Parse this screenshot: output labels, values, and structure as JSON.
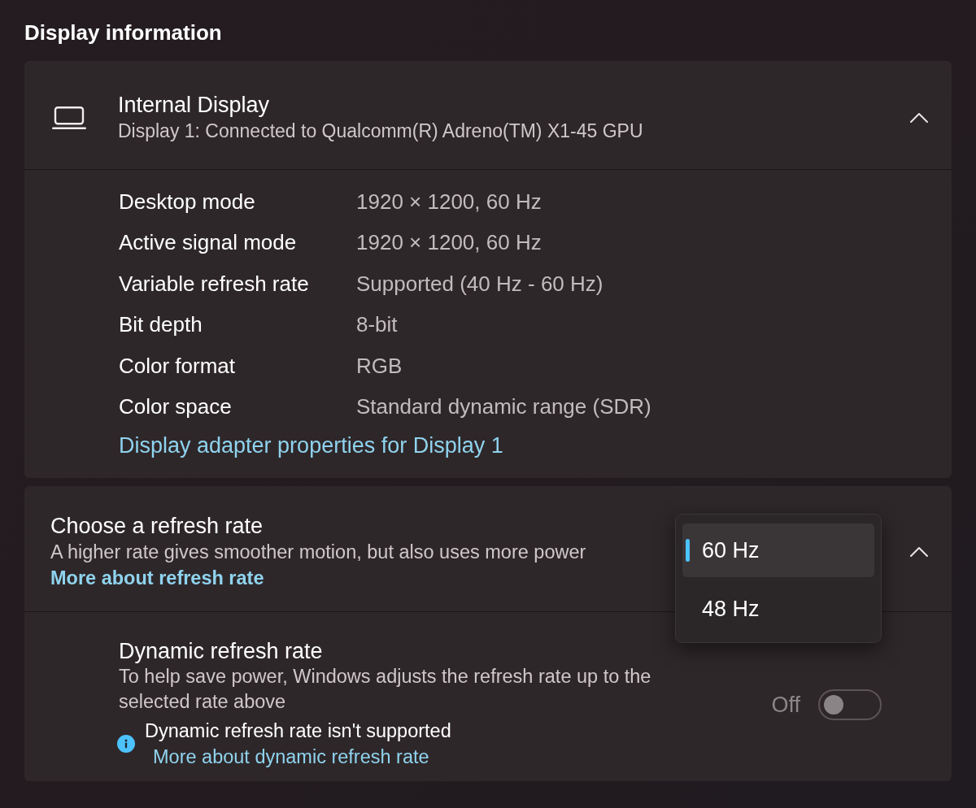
{
  "section_title": "Display information",
  "display_card": {
    "title": "Internal Display",
    "subtitle": "Display 1: Connected to Qualcomm(R) Adreno(TM) X1-45 GPU",
    "expanded": true,
    "properties": [
      {
        "label": "Desktop mode",
        "value": "1920 × 1200, 60 Hz"
      },
      {
        "label": "Active signal mode",
        "value": "1920 × 1200, 60 Hz"
      },
      {
        "label": "Variable refresh rate",
        "value": "Supported (40 Hz - 60 Hz)"
      },
      {
        "label": "Bit depth",
        "value": "8-bit"
      },
      {
        "label": "Color format",
        "value": "RGB"
      },
      {
        "label": "Color space",
        "value": "Standard dynamic range (SDR)"
      }
    ],
    "link": "Display adapter properties for Display 1"
  },
  "refresh_card": {
    "title": "Choose a refresh rate",
    "subtitle": "A higher rate gives smoother motion, but also uses more power",
    "link": "More about refresh rate",
    "expanded": true,
    "dropdown": {
      "options": [
        {
          "label": "60 Hz",
          "selected": true
        },
        {
          "label": "48 Hz",
          "selected": false
        }
      ]
    },
    "dynamic_refresh": {
      "title": "Dynamic refresh rate",
      "description": "To help save power, Windows adjusts the refresh rate up to the selected rate above",
      "notice": "Dynamic refresh rate isn't supported",
      "notice_link": "More about dynamic refresh rate",
      "toggle_label": "Off",
      "on": false,
      "disabled": true
    }
  }
}
